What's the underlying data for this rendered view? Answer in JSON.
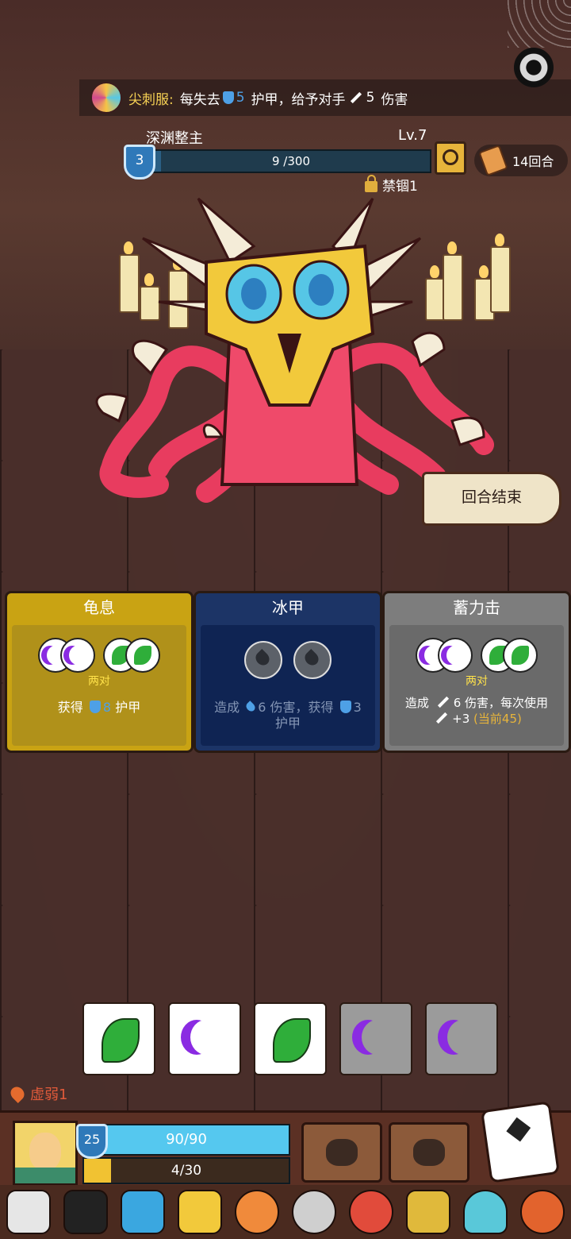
{
  "top_effect": {
    "name": "尖刺服:",
    "text_prefix": "每失去",
    "armor_value": "5",
    "text_middle": "护甲，给予对手",
    "damage_value": "5",
    "text_suffix": "伤害"
  },
  "boss": {
    "name": "深渊整主",
    "level": "Lv.7",
    "shield": "3",
    "hp_text": "9 /300",
    "hp_fraction": 0.03,
    "status": "禁锢1"
  },
  "turns": "14回合",
  "end_turn_label": "回合结束",
  "cards": [
    {
      "title": "龟息",
      "requirement": "两对",
      "desc_prefix": "获得",
      "desc_value": "8",
      "desc_suffix": "护甲"
    },
    {
      "title": "冰甲",
      "desc_part1": "造成",
      "desc_value1": "6",
      "desc_part2": "伤害，获得",
      "desc_value2": "3",
      "desc_part3": "护甲"
    },
    {
      "title": "蓄力击",
      "requirement": "两对",
      "desc_part1": "造成",
      "desc_value1": "6",
      "desc_part2": "伤害，每次使用",
      "desc_value2": "+3",
      "desc_note": "(当前45)"
    }
  ],
  "dice": [
    "leaf",
    "moon",
    "leaf",
    "moon",
    "moon"
  ],
  "player": {
    "status": "虚弱1",
    "shield": "25",
    "hp_text": "90/90",
    "hp_fraction": 1.0,
    "xp_text": "4/30",
    "xp_fraction": 0.133
  },
  "colors": {
    "armor_blue": "#4ea0e6",
    "pair_yellow": "#ffe24a",
    "moon_purple": "#8a2be2",
    "leaf_green": "#2fae3a"
  },
  "relics": [
    "skull-helmet",
    "top-hat",
    "blue-shield",
    "gold-helmet",
    "donut-badge",
    "silver-ring",
    "spiky-sun",
    "dice-box",
    "blue-slime",
    "roast-meat"
  ]
}
